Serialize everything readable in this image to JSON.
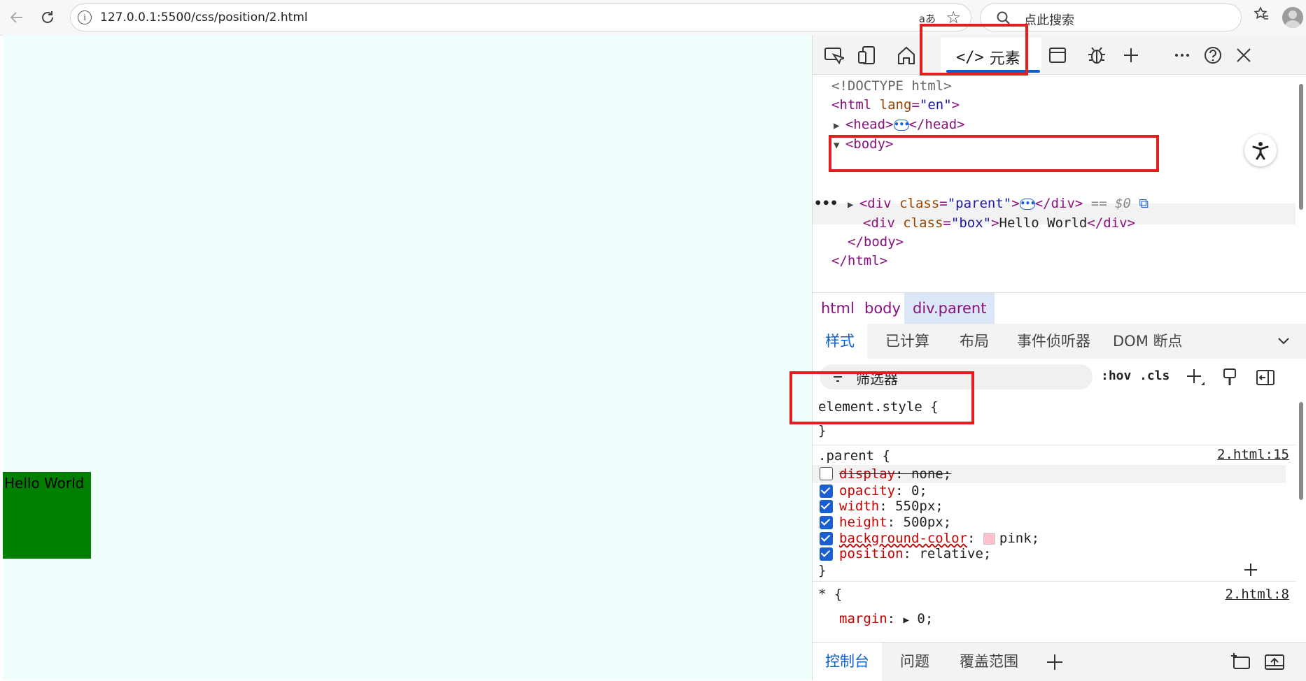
{
  "browser": {
    "url": "127.0.0.1:5500/css/position/2.html",
    "read_aloud": "aあ",
    "search_placeholder": "点此搜索"
  },
  "page": {
    "box_text": "Hello World",
    "background": "#f0fefe",
    "box_color": "#008000"
  },
  "devtools": {
    "active_tab": "元素",
    "dom": {
      "doctype": "<!DOCTYPE html>",
      "html_open_tag": "html",
      "lang_attr": "lang",
      "lang_val": "\"en\"",
      "head_open": "<head>",
      "head_close": "</head>",
      "body_open": "<body>",
      "parent_open_tag": "<div",
      "class_attr": "class",
      "parent_class_val": "\"parent\"",
      "parent_close": "</div>",
      "selected_marker": "== $0",
      "box_open_tag": "<div",
      "box_class_val": "\"box\"",
      "box_text": "Hello World",
      "box_close": "</div>",
      "body_close": "</body>",
      "html_close": "</html>"
    },
    "breadcrumb": [
      "html",
      "body",
      "div.parent"
    ],
    "subtabs": [
      "样式",
      "已计算",
      "布局",
      "事件侦听器",
      "DOM 断点"
    ],
    "filter_placeholder": "筛选器",
    "hov": ":hov",
    "cls": ".cls",
    "styles": {
      "element_style": "element.style {",
      "close_brace": "}",
      "parent_selector": ".parent {",
      "parent_source": "2.html:15",
      "properties": [
        {
          "name": "display",
          "value": "none;",
          "enabled": false
        },
        {
          "name": "opacity",
          "value": "0;",
          "enabled": true
        },
        {
          "name": "width",
          "value": "550px;",
          "enabled": true
        },
        {
          "name": "height",
          "value": "500px;",
          "enabled": true
        },
        {
          "name": "background-color",
          "value": "pink;",
          "enabled": true
        },
        {
          "name": "position",
          "value": "relative;",
          "enabled": true
        }
      ],
      "universal_selector": "* {",
      "universal_source": "2.html:8",
      "margin_prop": "margin",
      "margin_val": "0;"
    },
    "drawer_tabs": [
      "控制台",
      "问题",
      "覆盖范围"
    ]
  },
  "colors": {
    "highlight_red": "#e21e1e",
    "accent_blue": "#0b61d1"
  }
}
